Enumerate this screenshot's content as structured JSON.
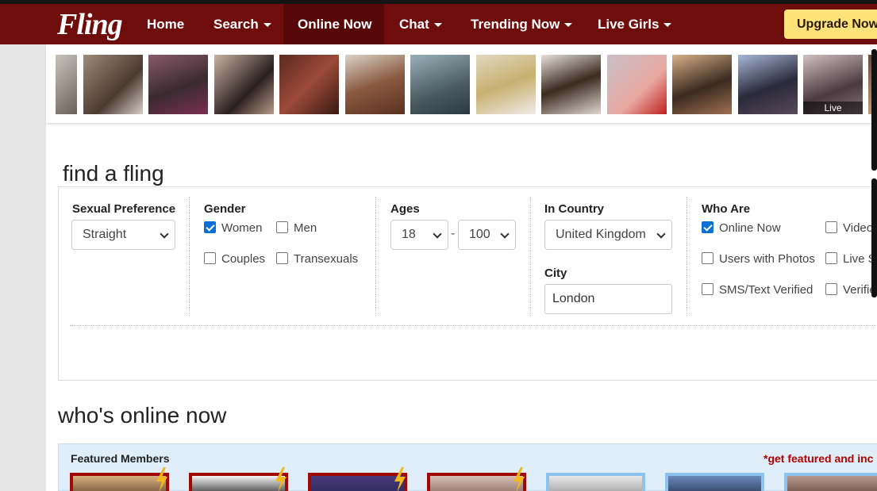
{
  "header": {
    "logo": "Fling",
    "nav": [
      {
        "label": "Home",
        "dropdown": false,
        "active": false
      },
      {
        "label": "Search",
        "dropdown": true,
        "active": false
      },
      {
        "label": "Online Now",
        "dropdown": false,
        "active": true
      },
      {
        "label": "Chat",
        "dropdown": true,
        "active": false
      },
      {
        "label": "Trending Now",
        "dropdown": true,
        "active": false
      },
      {
        "label": "Live Girls",
        "dropdown": true,
        "active": false
      }
    ],
    "upgrade_label": "Upgrade Now"
  },
  "photo_strip": {
    "live_label": "Live"
  },
  "find": {
    "title": "find a fling",
    "sexual_preference": {
      "label": "Sexual Preference",
      "value": "Straight"
    },
    "gender": {
      "label": "Gender",
      "options": [
        {
          "label": "Women",
          "checked": true
        },
        {
          "label": "Men",
          "checked": false
        },
        {
          "label": "Couples",
          "checked": false
        },
        {
          "label": "Transexuals",
          "checked": false
        }
      ]
    },
    "ages": {
      "label": "Ages",
      "min": "18",
      "separator": "-",
      "max": "100"
    },
    "country": {
      "label": "In Country",
      "value": "United Kingdom"
    },
    "city": {
      "label": "City",
      "value": "London"
    },
    "who_are": {
      "label": "Who Are",
      "options": [
        {
          "label": "Online Now",
          "checked": true
        },
        {
          "label": "Video",
          "checked": false
        },
        {
          "label": "Users with Photos",
          "checked": false
        },
        {
          "label": "Live S",
          "checked": false
        },
        {
          "label": "SMS/Text Verified",
          "checked": false
        },
        {
          "label": "Verifie",
          "checked": false
        }
      ]
    }
  },
  "online": {
    "title": "who's online now",
    "featured_label": "Featured Members",
    "featured_link": "*get featured and inc"
  },
  "colors": {
    "nav_bg": "#6f0c0c",
    "nav_active": "#560707",
    "upgrade_bg": "#ffe27a",
    "checkbox_checked": "#0b6fd6",
    "featured_bg": "#dfeef8",
    "featured_link": "#b00000"
  },
  "icons": {
    "caret": "caret-down-icon",
    "featured_badge": "lightning-bolt-icon",
    "select": "chevron-down-icon"
  }
}
